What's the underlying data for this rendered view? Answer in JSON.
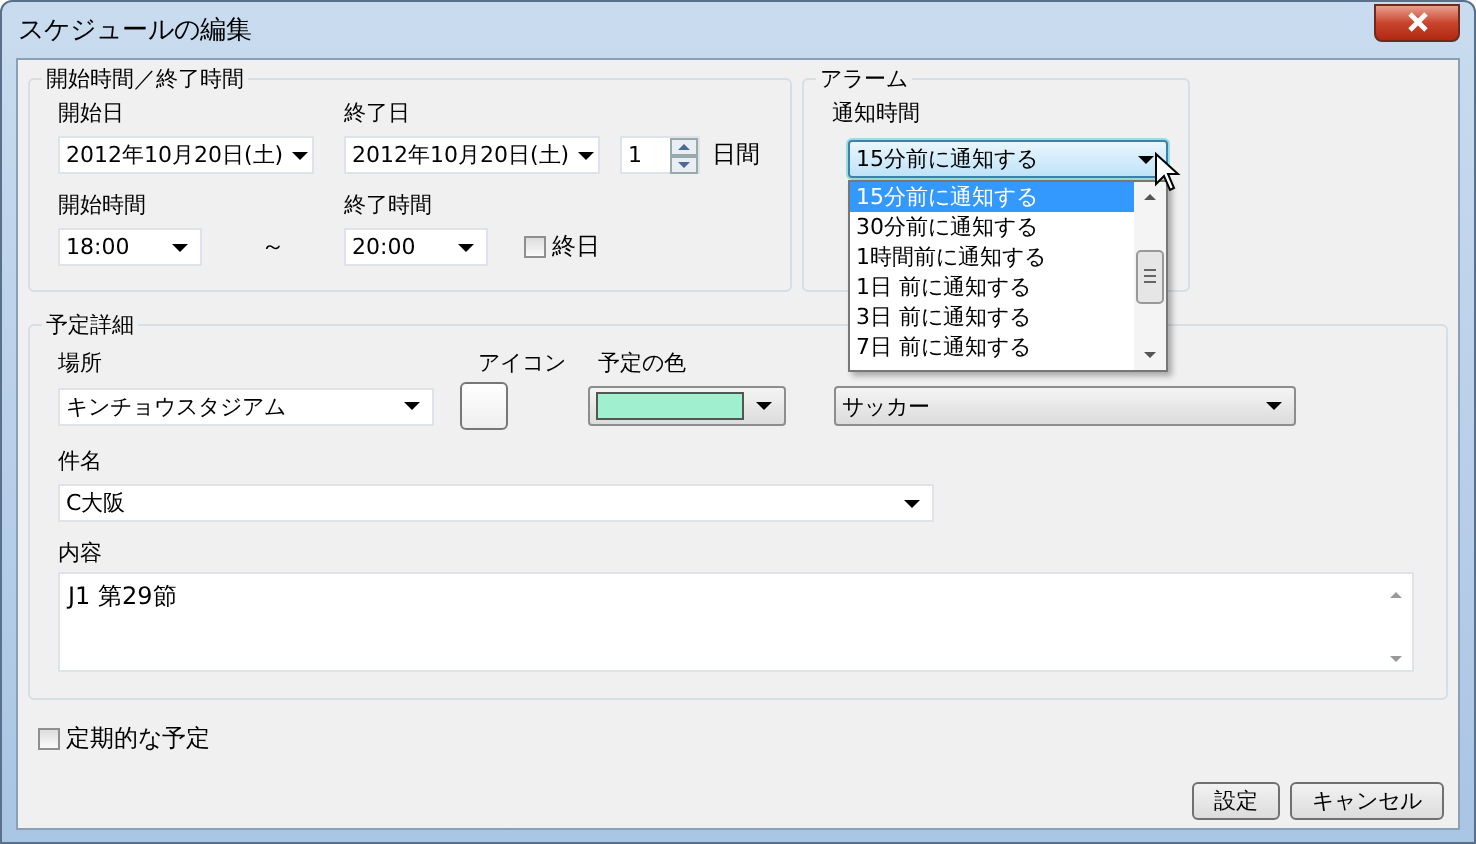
{
  "window": {
    "title": "スケジュールの編集"
  },
  "time_group": {
    "title": "開始時間／終了時間",
    "start_date": {
      "label": "開始日",
      "value": "2012年10月20日(土)"
    },
    "end_date": {
      "label": "終了日",
      "value": "2012年10月20日(土)"
    },
    "days": {
      "value": "1",
      "unit": "日間"
    },
    "start_time": {
      "label": "開始時間",
      "value": "18:00"
    },
    "separator": "～",
    "end_time": {
      "label": "終了時間",
      "value": "20:00"
    },
    "all_day": {
      "label": "終日",
      "checked": false
    }
  },
  "alarm_group": {
    "title": "アラーム",
    "notify_time": {
      "label": "通知時間",
      "value": "15分前に通知する",
      "open": true,
      "options": [
        {
          "label": "15分前に通知する",
          "selected": true
        },
        {
          "label": "30分前に通知する",
          "selected": false
        },
        {
          "label": "1時間前に通知する",
          "selected": false
        },
        {
          "label": "1日 前に通知する",
          "selected": false
        },
        {
          "label": "3日 前に通知する",
          "selected": false
        },
        {
          "label": "7日 前に通知する",
          "selected": false
        }
      ]
    }
  },
  "details_group": {
    "title": "予定詳細",
    "place": {
      "label": "場所",
      "value": "キンチョウスタジアム"
    },
    "icon": {
      "label": "アイコン"
    },
    "event_color": {
      "label": "予定の色",
      "color": "#a0f0d0"
    },
    "category": {
      "value": "サッカー"
    },
    "subject": {
      "label": "件名",
      "value": "C大阪"
    },
    "content": {
      "label": "内容",
      "value": "J1 第29節"
    }
  },
  "recurring": {
    "label": "定期的な予定",
    "checked": false
  },
  "buttons": [
    "設定",
    "キャンセル"
  ]
}
